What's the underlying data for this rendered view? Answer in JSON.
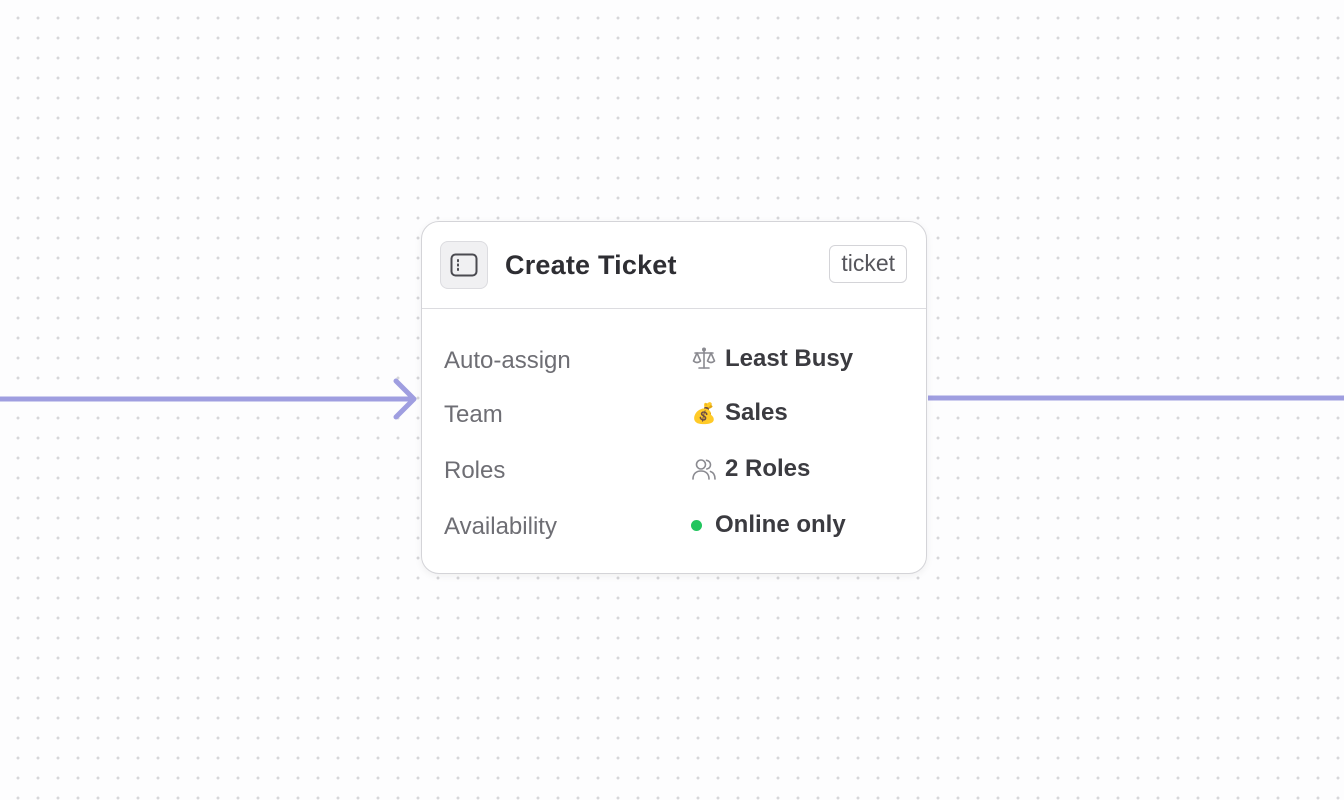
{
  "node": {
    "title": "Create Ticket",
    "tag": "ticket",
    "icon": "sidebar-panel-icon",
    "properties": [
      {
        "label": "Auto-assign",
        "value": "Least Busy",
        "icon": "scale-icon"
      },
      {
        "label": "Team",
        "value": "Sales",
        "icon": "money-bag-emoji",
        "emoji": "💰"
      },
      {
        "label": "Roles",
        "value": "2 Roles",
        "icon": "users-icon"
      },
      {
        "label": "Availability",
        "value": "Online only",
        "icon": "status-dot",
        "status_color": "#22c55e"
      }
    ]
  },
  "edges": {
    "color": "#9f9ee0",
    "incoming": {
      "arrow": "chevron-right"
    },
    "outgoing": {}
  },
  "canvas": {
    "background": "#fdfdfe",
    "dot_color": "#d6d6d9"
  }
}
